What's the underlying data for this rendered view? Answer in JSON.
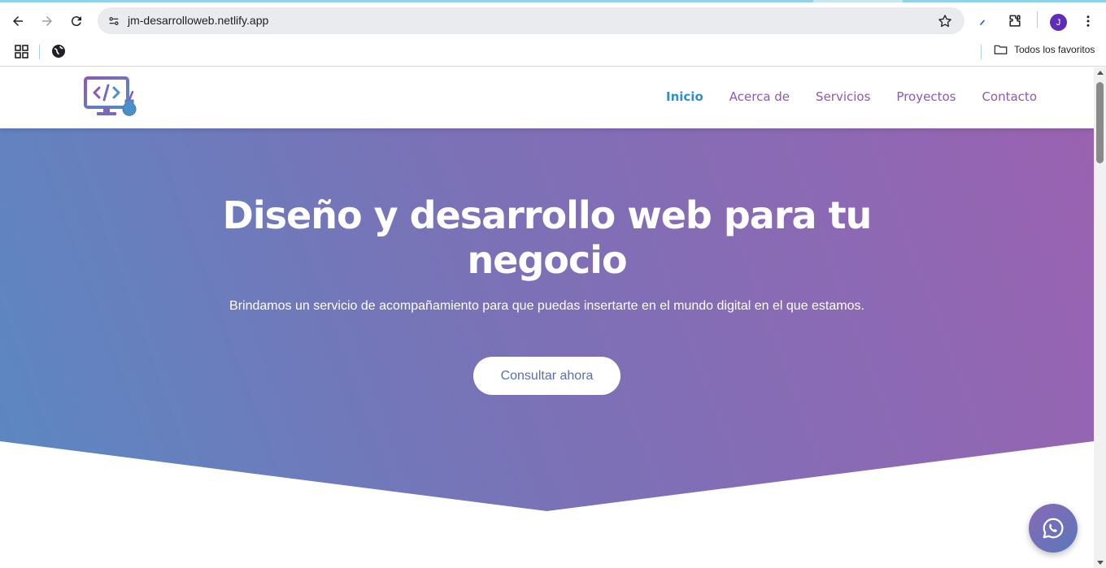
{
  "browser": {
    "url": "jm-desarrolloweb.netlify.app",
    "profile_initial": "J",
    "bookmarks_folder_label": "Todos los favoritos",
    "icons": [
      "back-icon",
      "forward-icon",
      "reload-icon",
      "site-info-icon",
      "star-icon",
      "pen-icon",
      "extensions-icon",
      "menu-dots-icon",
      "apps-icon",
      "globe-icon",
      "folder-icon"
    ]
  },
  "site": {
    "nav": [
      {
        "label": "Inicio",
        "active": true
      },
      {
        "label": "Acerca de",
        "active": false
      },
      {
        "label": "Servicios",
        "active": false
      },
      {
        "label": "Proyectos",
        "active": false
      },
      {
        "label": "Contacto",
        "active": false
      }
    ],
    "hero": {
      "title": "Diseño y desarrollo web para tu negocio",
      "subtitle": "Brindamos un servicio de acompañamiento para que puedas insertarte en el mundo digital en el que estamos.",
      "cta_label": "Consultar ahora"
    },
    "colors": {
      "gradient_start": "#5b88c2",
      "gradient_end": "#9a62b1",
      "nav_link": "#8e58b5",
      "nav_active": "#2f8fc7"
    },
    "floating_icon": "whatsapp-icon"
  }
}
